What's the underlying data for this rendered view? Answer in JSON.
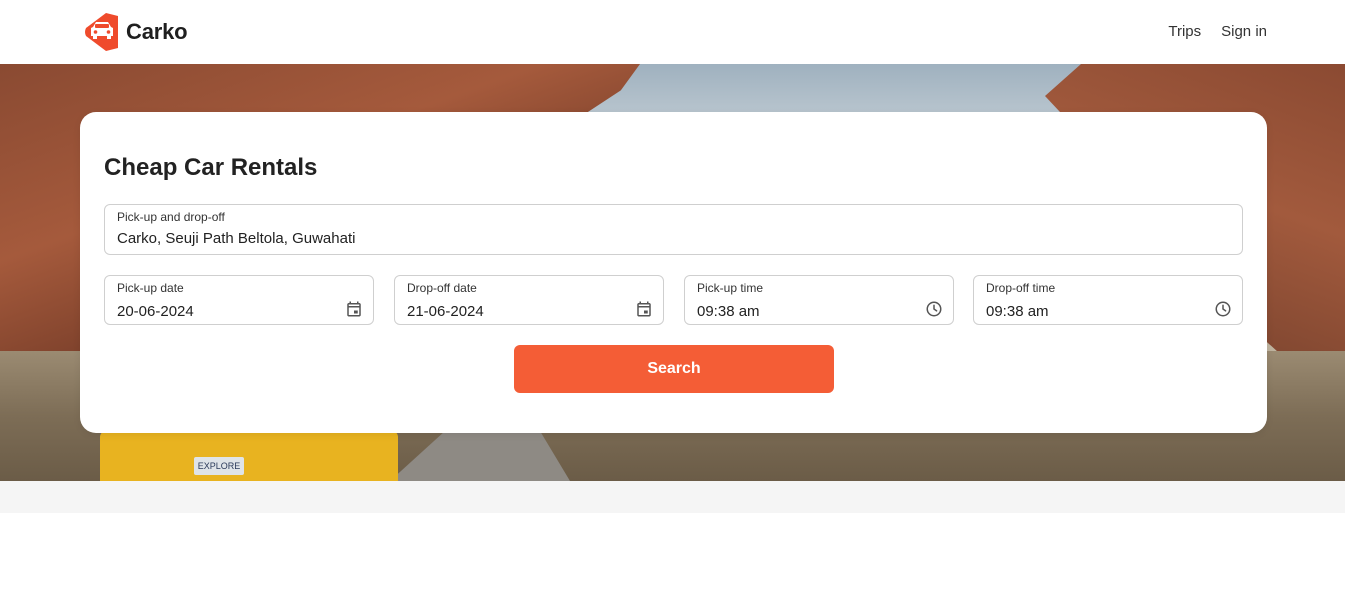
{
  "header": {
    "brand_name": "Carko",
    "nav": [
      {
        "label": "Trips"
      },
      {
        "label": "Sign in"
      }
    ]
  },
  "hero": {
    "van_plate": "EXPLORE"
  },
  "search_card": {
    "title": "Cheap Car Rentals",
    "location": {
      "label": "Pick-up and drop-off",
      "value": "Carko, Seuji Path Beltola, Guwahati"
    },
    "pickup_date": {
      "label": "Pick-up date",
      "value": "20-06-2024",
      "icon": "calendar-icon"
    },
    "dropoff_date": {
      "label": "Drop-off date",
      "value": "21-06-2024",
      "icon": "calendar-icon"
    },
    "pickup_time": {
      "label": "Pick-up time",
      "value": "09:38 am",
      "icon": "clock-icon"
    },
    "dropoff_time": {
      "label": "Drop-off time",
      "value": "09:38 am",
      "icon": "clock-icon"
    },
    "search_label": "Search"
  },
  "colors": {
    "accent": "#f45d36",
    "brand_red": "#ef4b2c"
  }
}
